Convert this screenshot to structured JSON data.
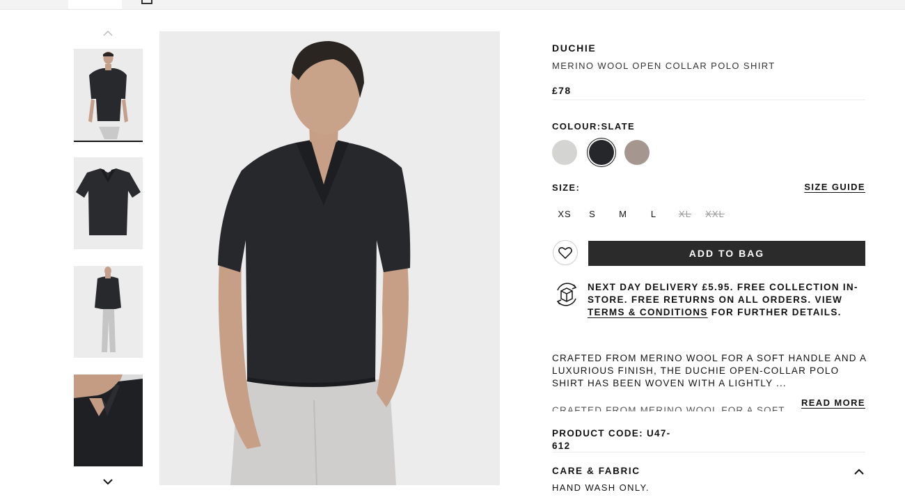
{
  "product": {
    "brand": "DUCHIE",
    "name": "MERINO WOOL OPEN COLLAR POLO SHIRT",
    "price": "£78"
  },
  "colour": {
    "label": "COLOUR:",
    "selected": "SLATE",
    "swatches": [
      {
        "name": "light grey",
        "hex": "#d4d4d2"
      },
      {
        "name": "slate",
        "hex": "#26272b"
      },
      {
        "name": "taupe",
        "hex": "#a59690"
      }
    ]
  },
  "size": {
    "label": "SIZE:",
    "guide_label": "SIZE GUIDE",
    "options": [
      {
        "label": "XS",
        "available": true
      },
      {
        "label": "S",
        "available": true
      },
      {
        "label": "M",
        "available": true
      },
      {
        "label": "L",
        "available": true
      },
      {
        "label": "XL",
        "available": false
      },
      {
        "label": "XXL",
        "available": false
      }
    ]
  },
  "actions": {
    "add_to_bag": "ADD TO BAG",
    "wishlist_icon": "heart-icon"
  },
  "delivery": {
    "text_before": "NEXT DAY DELIVERY £5.95. FREE COLLECTION IN-STORE. FREE RETURNS ON ALL ORDERS. VIEW ",
    "link": "TERMS & CONDITIONS",
    "text_after": " FOR FURTHER DETAILS."
  },
  "description": {
    "text": "CRAFTED FROM MERINO WOOL FOR A SOFT HANDLE AND A LUXURIOUS FINISH, THE DUCHIE OPEN-COLLAR POLO SHIRT HAS BEEN WOVEN WITH A LIGHTLY ...",
    "faded_repeat": "CRAFTED FROM MERINO WOOL FOR A SOFT",
    "read_more": "READ MORE"
  },
  "product_code": {
    "label": "PRODUCT CODE:",
    "value": "U47-612"
  },
  "care": {
    "title": "CARE & FABRIC",
    "text": "HAND WASH ONLY."
  },
  "colors": {
    "button_bg": "#2b2b2b",
    "image_bg": "#ececec"
  }
}
